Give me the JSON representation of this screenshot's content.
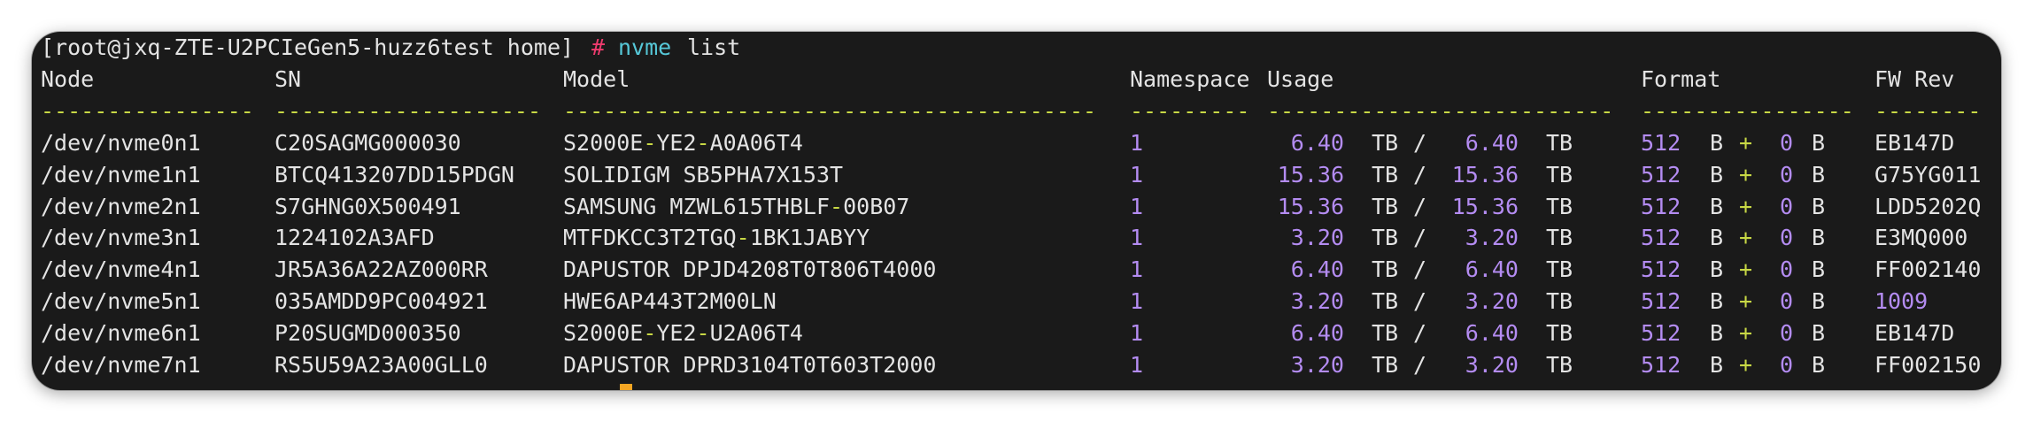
{
  "prompt": {
    "text": "[root@jxq-ZTE-U2PCIeGen5-huzz6test home]",
    "hash": "#",
    "command": "nvme",
    "args": "list"
  },
  "headers": {
    "node": "Node",
    "sn": "SN",
    "model": "Model",
    "namespace": "Namespace",
    "usage": "Usage",
    "format": "Format",
    "fw": "FW Rev"
  },
  "dashes": {
    "node": "----------------",
    "sn": "--------------------",
    "model": "----------------------------------------",
    "namespace": "---------",
    "usage": "--------------------------",
    "format": "----------------",
    "fw": "--------"
  },
  "devices": [
    {
      "node": "/dev/nvme0n1",
      "sn": "C20SAGMG000030",
      "model_parts": [
        "S2000E",
        "-",
        "YE2",
        "-",
        "A0A06T4"
      ],
      "ns": "1",
      "used": "6.40",
      "used_unit": "TB",
      "sep": "/",
      "total": "6.40",
      "total_unit": "TB",
      "lba": "512",
      "lba_unit": "B",
      "plus": "+",
      "meta": "0",
      "meta_unit": "B",
      "fw": "EB147D"
    },
    {
      "node": "/dev/nvme1n1",
      "sn": "BTCQ413207DD15PDGN",
      "model_parts": [
        "SOLIDIGM SB5PHA7X153T"
      ],
      "ns": "1",
      "used": "15.36",
      "used_unit": "TB",
      "sep": "/",
      "total": "15.36",
      "total_unit": "TB",
      "lba": "512",
      "lba_unit": "B",
      "plus": "+",
      "meta": "0",
      "meta_unit": "B",
      "fw": "G75YG011"
    },
    {
      "node": "/dev/nvme2n1",
      "sn": "S7GHNG0X500491",
      "model_parts": [
        "SAMSUNG MZWL615THBLF",
        "-",
        "00B07"
      ],
      "ns": "1",
      "used": "15.36",
      "used_unit": "TB",
      "sep": "/",
      "total": "15.36",
      "total_unit": "TB",
      "lba": "512",
      "lba_unit": "B",
      "plus": "+",
      "meta": "0",
      "meta_unit": "B",
      "fw": "LDD5202Q"
    },
    {
      "node": "/dev/nvme3n1",
      "sn": "1224102A3AFD",
      "model_parts": [
        "MTFDKCC3T2TGQ",
        "-",
        "1BK1JABYY"
      ],
      "ns": "1",
      "used": "3.20",
      "used_unit": "TB",
      "sep": "/",
      "total": "3.20",
      "total_unit": "TB",
      "lba": "512",
      "lba_unit": "B",
      "plus": "+",
      "meta": "0",
      "meta_unit": "B",
      "fw": "E3MQ000"
    },
    {
      "node": "/dev/nvme4n1",
      "sn": "JR5A36A22AZ000RR",
      "model_parts": [
        "DAPUSTOR DPJD4208T0T806T4000"
      ],
      "ns": "1",
      "used": "6.40",
      "used_unit": "TB",
      "sep": "/",
      "total": "6.40",
      "total_unit": "TB",
      "lba": "512",
      "lba_unit": "B",
      "plus": "+",
      "meta": "0",
      "meta_unit": "B",
      "fw": "FF002140"
    },
    {
      "node": "/dev/nvme5n1",
      "sn": "035AMDD9PC004921",
      "model_parts": [
        "HWE6AP443T2M00LN"
      ],
      "ns": "1",
      "used": "3.20",
      "used_unit": "TB",
      "sep": "/",
      "total": "3.20",
      "total_unit": "TB",
      "lba": "512",
      "lba_unit": "B",
      "plus": "+",
      "meta": "0",
      "meta_unit": "B",
      "fw": "1009",
      "fw_numeric": true
    },
    {
      "node": "/dev/nvme6n1",
      "sn": "P20SUGMD000350",
      "model_parts": [
        "S2000E",
        "-",
        "YE2",
        "-",
        "U2A06T4"
      ],
      "ns": "1",
      "used": "6.40",
      "used_unit": "TB",
      "sep": "/",
      "total": "6.40",
      "total_unit": "TB",
      "lba": "512",
      "lba_unit": "B",
      "plus": "+",
      "meta": "0",
      "meta_unit": "B",
      "fw": "EB147D"
    },
    {
      "node": "/dev/nvme7n1",
      "sn": "RS5U59A23A00GLL0",
      "model_parts": [
        "DAPUSTOR DPRD3104T0T603T2000"
      ],
      "ns": "1",
      "used": "3.20",
      "used_unit": "TB",
      "sep": "/",
      "total": "3.20",
      "total_unit": "TB",
      "lba": "512",
      "lba_unit": "B",
      "plus": "+",
      "meta": "0",
      "meta_unit": "B",
      "fw": "FF002150"
    }
  ],
  "colors": {
    "background": "#1a1a1a",
    "text": "#e4e4e4",
    "number": "#b48cf2",
    "dash": "#c8d845",
    "command": "#56c8d8",
    "prompt_hash": "#ee3b6e",
    "cursor": "#f5a623"
  }
}
